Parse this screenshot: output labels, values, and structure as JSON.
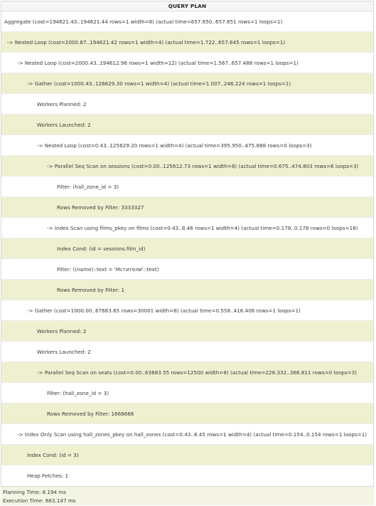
{
  "header": "QUERY PLAN",
  "rows": [
    {
      "text": "Aggregate  (cost=194621.43..194621.44 rows=1 width=8) (actual time=657.650..657.651 rows=1 loops=1)",
      "indent": 4,
      "shade": "light"
    },
    {
      "text": "->  Nested Loop  (cost=2000.87..194621.42 rows=1 width=4) (actual time=1.722..657.645 rows=1 loops=1)",
      "indent": 8,
      "shade": "dark"
    },
    {
      "text": "->  Nested Loop  (cost=2000.43..194612.96 rows=1 width=12) (actual time=1.567..657.488 rows=1 loops=1)",
      "indent": 22,
      "shade": "light"
    },
    {
      "text": "->  Gather  (cost=1000.43..126629.30 rows=1 width=4) (actual time=1.007..246.224 rows=1 loops=1)",
      "indent": 36,
      "shade": "dark"
    },
    {
      "text": "Workers Planned: 2",
      "indent": 50,
      "shade": "light"
    },
    {
      "text": "Workers Launched: 2",
      "indent": 50,
      "shade": "dark"
    },
    {
      "text": "->  Nested Loop  (cost=0.43..125629.20 rows=1 width=4) (actual time=395.950..475.888 rows=0 loops=3)",
      "indent": 50,
      "shade": "light"
    },
    {
      "text": "->  Parallel Seq Scan on sessions  (cost=0.00..125612.73 rows=1 width=8) (actual time=0.675..474.803 rows=6 loops=3)",
      "indent": 64,
      "shade": "dark"
    },
    {
      "text": "Filter: (hall_zone_id = 3)",
      "indent": 78,
      "shade": "light"
    },
    {
      "text": "Rows Removed by Filter: 3333327",
      "indent": 78,
      "shade": "dark"
    },
    {
      "text": "->  Index Scan using films_pkey on films  (cost=0.43..8.46 rows=1 width=4) (actual time=0.178..0.178 rows=0 loops=18)",
      "indent": 64,
      "shade": "light"
    },
    {
      "text": "Index Cond: (id = sessions.film_id)",
      "indent": 78,
      "shade": "dark"
    },
    {
      "text": "Filter: ((name)::text = 'Мстители'::text)",
      "indent": 78,
      "shade": "light"
    },
    {
      "text": "Rows Removed by Filter: 1",
      "indent": 78,
      "shade": "dark"
    },
    {
      "text": "->  Gather  (cost=1000.00..67683.65 rows=30001 width=8) (actual time=0.558..416.406 rows=1 loops=1)",
      "indent": 36,
      "shade": "light"
    },
    {
      "text": "Workers Planned: 2",
      "indent": 50,
      "shade": "dark"
    },
    {
      "text": "Workers Launched: 2",
      "indent": 50,
      "shade": "light"
    },
    {
      "text": "->  Parallel Seq Scan on seats  (cost=0.00..63683.55 rows=12500 width=8) (actual time=228.332..366.811 rows=0 loops=3)",
      "indent": 50,
      "shade": "dark"
    },
    {
      "text": "Filter: (hall_zone_id = 3)",
      "indent": 64,
      "shade": "light"
    },
    {
      "text": "Rows Removed by Filter: 1666666",
      "indent": 64,
      "shade": "dark"
    },
    {
      "text": "->  Index Only Scan using hall_zones_pkey on hall_zones  (cost=0.43..8.45 rows=1 width=4) (actual time=0.154..0.154 rows=1 loops=1)",
      "indent": 22,
      "shade": "light"
    },
    {
      "text": "Index Cond: (id = 3)",
      "indent": 36,
      "shade": "dark"
    },
    {
      "text": "Heap Fetches: 1",
      "indent": 36,
      "shade": "light"
    }
  ],
  "planning_time": "Planning Time: 8.194 ms",
  "execution_time": "Execution Time: 663.147 ms"
}
